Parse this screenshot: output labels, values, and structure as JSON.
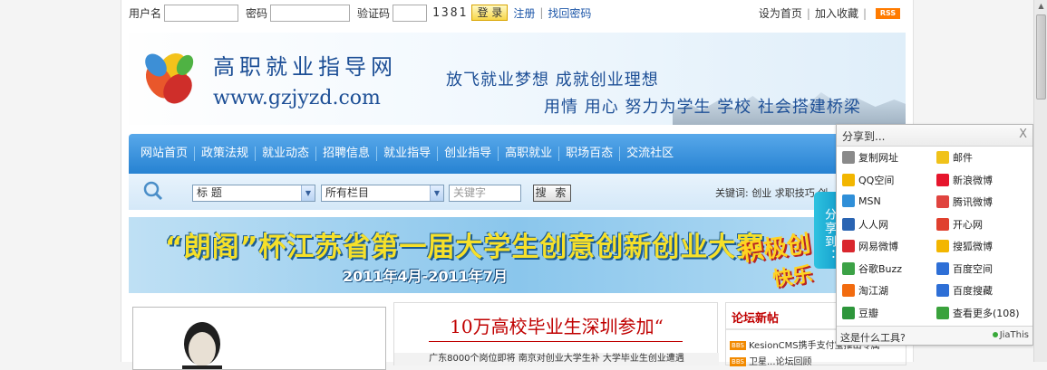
{
  "login": {
    "username_label": "用户名",
    "password_label": "密码",
    "captcha_label": "验证码",
    "captcha_code": "1381",
    "login_button": "登 录",
    "register": "注册",
    "forgot": "找回密码",
    "separator": "|"
  },
  "toplinks": {
    "homepage": "设为首页",
    "favorite": "加入收藏",
    "rss": "RSS"
  },
  "header": {
    "site_name": "高职就业指导网",
    "site_url": "www.gzjyzd.com",
    "slogan1": "放飞就业梦想 成就创业理想",
    "slogan2": "用情 用心 努力为学生 学校 社会搭建桥梁"
  },
  "nav": {
    "items": [
      "网站首页",
      "政策法规",
      "就业动态",
      "招聘信息",
      "就业指导",
      "创业指导",
      "高职就业",
      "职场百态",
      "交流社区"
    ]
  },
  "search": {
    "field_select": "标 题",
    "column_select": "所有栏目",
    "keyword_placeholder": "关键字",
    "button": "搜 索",
    "hotwords": "关键词: 创业 求职技巧 创"
  },
  "banner": {
    "title": "“朗阁”杯江苏省第一届大学生创意创新创业大赛",
    "date": "2011年4月-2011年7月",
    "side1": "积极创",
    "side2": "快乐"
  },
  "content": {
    "headline": "10万高校毕业生深圳参加“",
    "summary": "广东8000个岗位即将 南京对创业大学生补 大学毕业生创业遭遇",
    "forum_title": "论坛新帖",
    "forum_items": [
      "KesionCMS携手支付宝推出专属",
      "卫星...论坛回顾"
    ],
    "bbs_badge": "BBS"
  },
  "share": {
    "tab": "分享到：",
    "title": "分享到...",
    "close": "X",
    "items": [
      {
        "label": "复制网址",
        "icon": "copy-icon",
        "color": "#8a8a8a"
      },
      {
        "label": "邮件",
        "icon": "mail-icon",
        "color": "#f0c21a"
      },
      {
        "label": "QQ空间",
        "icon": "qzone-icon",
        "color": "#f2b600"
      },
      {
        "label": "新浪微博",
        "icon": "sina-weibo-icon",
        "color": "#e6162d"
      },
      {
        "label": "MSN",
        "icon": "msn-icon",
        "color": "#2f8fd8"
      },
      {
        "label": "腾讯微博",
        "icon": "tencent-weibo-icon",
        "color": "#e0443f"
      },
      {
        "label": "人人网",
        "icon": "renren-icon",
        "color": "#2a64b2"
      },
      {
        "label": "开心网",
        "icon": "kaixin-icon",
        "color": "#e0402e"
      },
      {
        "label": "网易微博",
        "icon": "netease-weibo-icon",
        "color": "#d9272e"
      },
      {
        "label": "搜狐微博",
        "icon": "sohu-weibo-icon",
        "color": "#f3b600"
      },
      {
        "label": "谷歌Buzz",
        "icon": "google-buzz-icon",
        "color": "#3ca246"
      },
      {
        "label": "百度空间",
        "icon": "baidu-space-icon",
        "color": "#2e6fd6"
      },
      {
        "label": "淘江湖",
        "icon": "taojianghu-icon",
        "color": "#f26b0f"
      },
      {
        "label": "百度搜藏",
        "icon": "baidu-cang-icon",
        "color": "#2e6fd6"
      },
      {
        "label": "豆瓣",
        "icon": "douban-icon",
        "color": "#2d963b"
      },
      {
        "label": "查看更多(108)",
        "icon": "more-icon",
        "color": "#3aa23c"
      }
    ],
    "footer_left": "这是什么工具?",
    "footer_right": "JiaThis"
  }
}
